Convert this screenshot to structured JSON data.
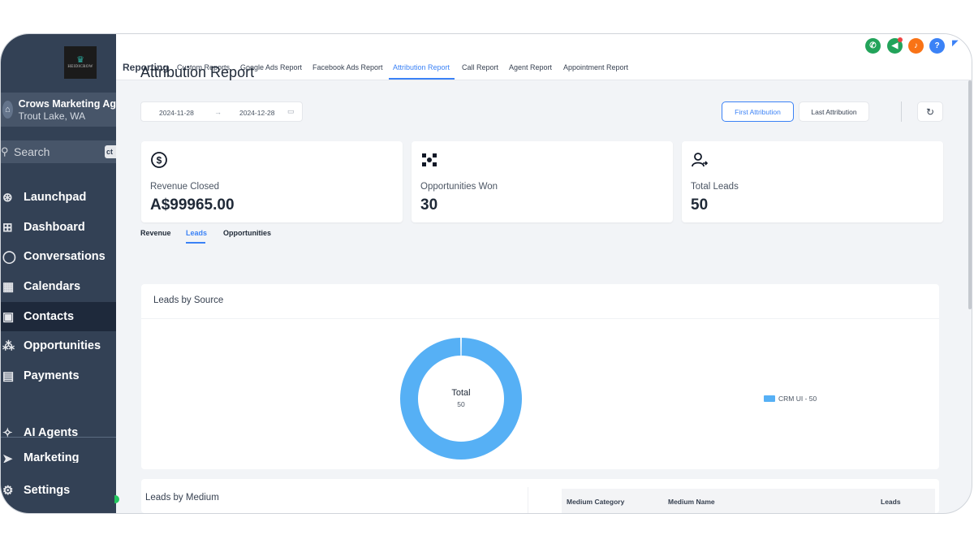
{
  "sidebar": {
    "logo_text": "HEIDICROW",
    "account": {
      "name": "Crows Marketing Ag",
      "location": "Trout Lake, WA"
    },
    "search": {
      "label": "Search",
      "shortcut": "ct"
    },
    "items": [
      {
        "label": "Launchpad",
        "icon": "rocket-icon"
      },
      {
        "label": "Dashboard",
        "icon": "grid-icon"
      },
      {
        "label": "Conversations",
        "icon": "chat-icon"
      },
      {
        "label": "Calendars",
        "icon": "calendar-icon"
      },
      {
        "label": "Contacts",
        "icon": "contacts-icon",
        "active": true
      },
      {
        "label": "Opportunities",
        "icon": "opportunities-icon"
      },
      {
        "label": "Payments",
        "icon": "payments-icon"
      },
      {
        "label": "AI Agents",
        "icon": "sparkle-icon"
      },
      {
        "label": "Marketing",
        "icon": "send-icon"
      },
      {
        "label": "Settings",
        "icon": "gear-icon"
      }
    ]
  },
  "topbar": {
    "title": "Reporting",
    "tabs": [
      "Custom Reports",
      "Google Ads Report",
      "Facebook Ads Report",
      "Attribution Report",
      "Call Report",
      "Agent Report",
      "Appointment Report"
    ],
    "active_tab": "Attribution Report",
    "icons": [
      {
        "name": "phone-icon",
        "color": "#22a35a",
        "glyph": "✆"
      },
      {
        "name": "megaphone-icon",
        "color": "#22a35a",
        "glyph": "✉"
      },
      {
        "name": "bell-icon",
        "color": "#f97316",
        "glyph": "🔔"
      },
      {
        "name": "help-icon",
        "color": "#3b82f6",
        "glyph": "?"
      }
    ]
  },
  "main": {
    "title": "Attribution Report",
    "date_start": "2024-11-28",
    "date_end": "2024-12-28",
    "first_attribution": "First Attribution",
    "last_attribution": "Last Attribution",
    "cards": [
      {
        "label": "Revenue Closed",
        "value": "A$99965.00",
        "icon": "dollar-icon"
      },
      {
        "label": "Opportunities Won",
        "value": "30",
        "icon": "opportunities-icon"
      },
      {
        "label": "Total Leads",
        "value": "50",
        "icon": "user-arrow-icon"
      }
    ],
    "subtabs": [
      "Revenue",
      "Leads",
      "Opportunities"
    ],
    "active_subtab": "Leads",
    "leads_by_source": {
      "title": "Leads by Source",
      "total_label": "Total",
      "total_value": "50",
      "legend": "CRM UI - 50"
    },
    "leads_by_medium": {
      "title": "Leads by Medium",
      "columns": [
        "Medium Category",
        "Medium Name",
        "Leads"
      ]
    }
  },
  "colors": {
    "accent": "#3b82f6",
    "sidebar": "#334155",
    "donut": "#56b0f5"
  },
  "chart_data": {
    "type": "pie",
    "categories": [
      "CRM UI"
    ],
    "values": [
      50
    ],
    "title": "Leads by Source"
  }
}
